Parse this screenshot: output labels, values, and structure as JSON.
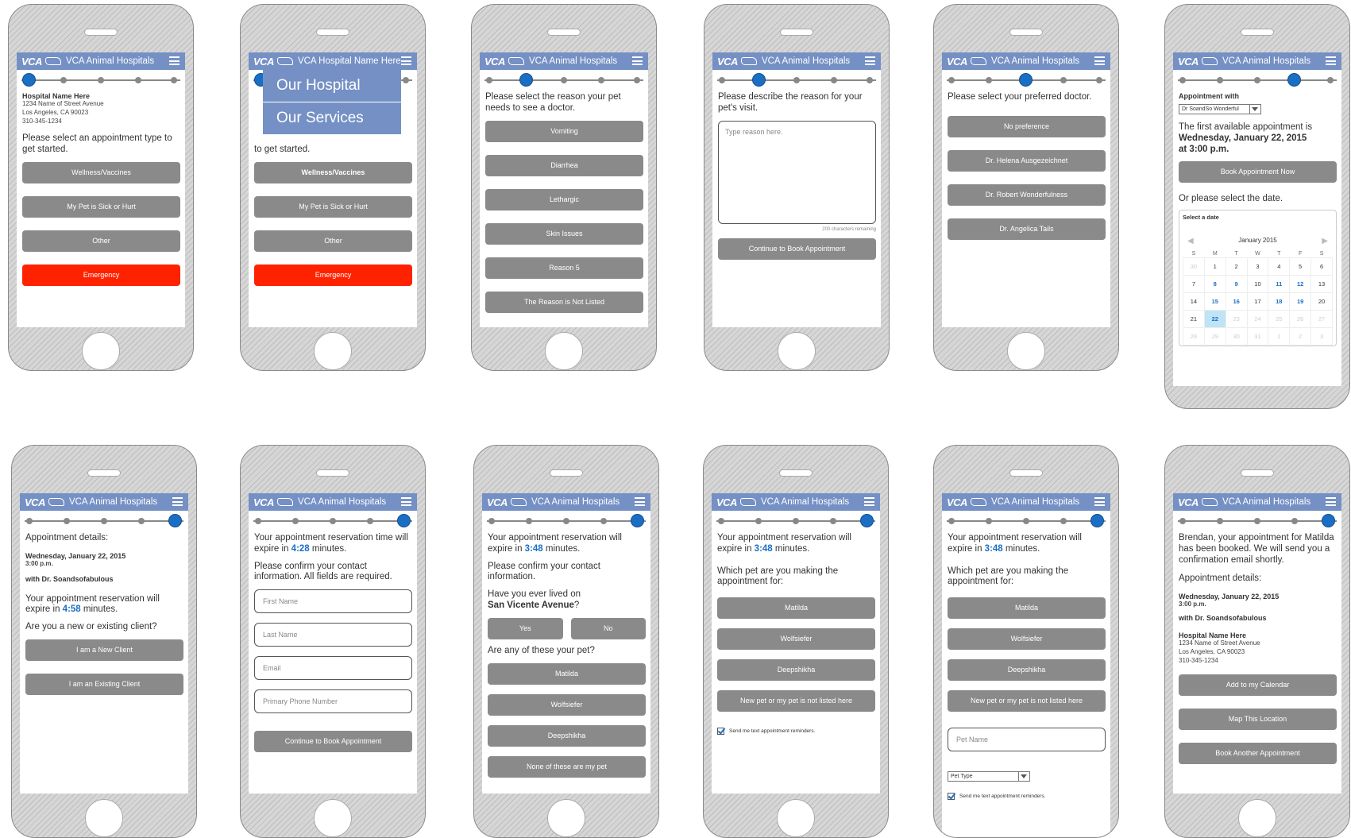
{
  "app": {
    "logo": "VCA",
    "title": "VCA Animal Hospitals",
    "title_alt": "VCA Hospital Name Here"
  },
  "hospital": {
    "name": "Hospital Name Here",
    "street": "1234 Name of Street Avenue",
    "city": "Los Angeles, CA 90023",
    "phone": "310-345-1234"
  },
  "menu": {
    "items": [
      "Our Hospital",
      "Our Services"
    ]
  },
  "screen1": {
    "prompt": "Please select an appointment type to get started.",
    "buttons": [
      "Wellness/Vaccines",
      "My Pet is Sick or Hurt",
      "Other",
      "Emergency"
    ]
  },
  "screen2": {
    "prompt_visible": "to get started."
  },
  "screen3": {
    "prompt": "Please select the reason your pet needs to see a doctor.",
    "buttons": [
      "Vomiting",
      "Diarrhea",
      "Lethargic",
      "Skin Issues",
      "Reason 5",
      "The Reason is Not Listed"
    ]
  },
  "screen4": {
    "prompt": "Please describe the reason for your pet's visit.",
    "placeholder": "Type reason here.",
    "chars": "200 characters remaining",
    "button": "Continue to Book Appointment"
  },
  "screen5": {
    "prompt": "Please select your preferred doctor.",
    "buttons": [
      "No preference",
      "Dr. Helena Ausgezeichnet",
      "Dr. Robert Wonderfulness",
      "Dr. Angelica Tails"
    ]
  },
  "screen6": {
    "label": "Appointment with",
    "doctor_select": "Dr SoandSo Wonderful",
    "first_line": "The first available appointment is",
    "first_date": "Wednesday, January 22, 2015",
    "first_time": "at 3:00 p.m.",
    "book_now": "Book Appointment Now",
    "or_select": "Or please select the date.",
    "calendar": {
      "select_label": "Select a date",
      "month": "January 2015",
      "weekdays": [
        "S",
        "M",
        "T",
        "W",
        "T",
        "F",
        "S"
      ],
      "weeks": [
        [
          "30",
          "1",
          "2",
          "3",
          "4",
          "5",
          "6"
        ],
        [
          "7",
          "8",
          "9",
          "10",
          "11",
          "12",
          "13"
        ],
        [
          "14",
          "15",
          "16",
          "17",
          "18",
          "19",
          "20"
        ],
        [
          "21",
          "22",
          "23",
          "24",
          "25",
          "26",
          "27"
        ],
        [
          "28",
          "29",
          "30",
          "31",
          "1",
          "2",
          "3"
        ]
      ],
      "selected": "22"
    }
  },
  "screen7": {
    "heading": "Appointment details:",
    "date": "Wednesday, January 22, 2015",
    "time": "3:00 p.m.",
    "doctor": "with Dr. Soandsofabulous",
    "expire_pre": "Your appointment reservation will expire in",
    "expire_time": "4:58",
    "expire_post": "minutes.",
    "question": "Are you a new or existing client?",
    "buttons": [
      "I am a New Client",
      "I am an Existing Client"
    ]
  },
  "screen8": {
    "expire_pre": "Your appointment reservation time will expire in",
    "expire_time": "4:28",
    "expire_post": "minutes.",
    "confirm": "Please confirm your contact information. All fields are required.",
    "fields": [
      "First Name",
      "Last Name",
      "Email",
      "Primary Phone Number"
    ],
    "button": "Continue to Book Appointment"
  },
  "screen9": {
    "expire_pre": "Your appointment reservation will expire in",
    "expire_time": "3:48",
    "expire_post": "minutes.",
    "confirm": "Please confirm your contact information.",
    "lived_pre": "Have you ever lived on",
    "street": "San Vicente Avenue",
    "lived_post": "?",
    "yes": "Yes",
    "no": "No",
    "pets_q": "Are any of these your pet?",
    "buttons": [
      "Matilda",
      "Wolfsiefer",
      "Deepshikha",
      "None of these are my pet"
    ]
  },
  "screen10": {
    "expire_pre": "Your appointment reservation will expire in",
    "expire_time": "3:48",
    "expire_post": "minutes.",
    "which": "Which pet are you making the appointment for:",
    "buttons": [
      "Matilda",
      "Wolfsiefer",
      "Deepshikha",
      "New pet or my pet is not listed here"
    ],
    "reminder": "Send me text appointment reminders."
  },
  "screen11": {
    "pet_name": "Pet Name",
    "pet_type": "Pet Type"
  },
  "screen12": {
    "message": "Brendan, your appointment for Matilda has been booked. We will send you a confirmation email shortly.",
    "buttons": [
      "Add to my Calendar",
      "Map This Location",
      "Book Another Appointment"
    ]
  }
}
